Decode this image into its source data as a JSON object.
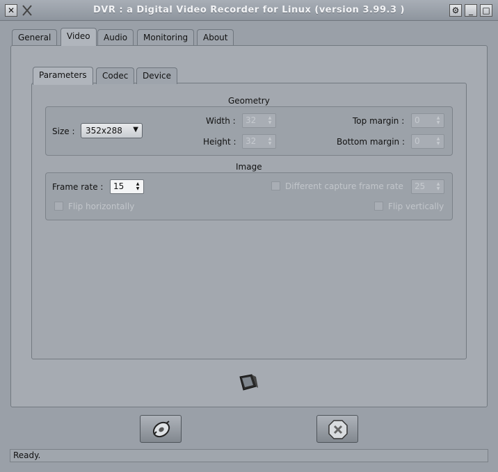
{
  "window": {
    "title": "DVR : a Digital Video Recorder for Linux (version 3.99.3 )",
    "close_glyph": "✕",
    "pin_glyph": "⚙",
    "min_glyph": "_",
    "max_glyph": "□"
  },
  "tabs": [
    {
      "label": "General"
    },
    {
      "label": "Video",
      "active": true
    },
    {
      "label": "Audio"
    },
    {
      "label": "Monitoring"
    },
    {
      "label": "About"
    }
  ],
  "subtabs": [
    {
      "label": "Parameters",
      "active": true
    },
    {
      "label": "Codec"
    },
    {
      "label": "Device"
    }
  ],
  "geometry": {
    "title": "Geometry",
    "size_label": "Size :",
    "size_value": "352x288",
    "width_label": "Width :",
    "width_value": "32",
    "height_label": "Height :",
    "height_value": "32",
    "top_margin_label": "Top margin :",
    "top_margin_value": "0",
    "bottom_margin_label": "Bottom margin :",
    "bottom_margin_value": "0"
  },
  "image": {
    "title": "Image",
    "frame_rate_label": "Frame rate :",
    "frame_rate_value": "15",
    "diff_capture_label": "Different capture frame rate",
    "diff_capture_value": "25",
    "flip_h_label": "Flip horizontally",
    "flip_v_label": "Flip vertically"
  },
  "status": {
    "text": "Ready."
  },
  "icons": {
    "monitor": "tv-monitor-icon",
    "start": "gear-disc-icon",
    "stop": "stop-x-icon"
  }
}
